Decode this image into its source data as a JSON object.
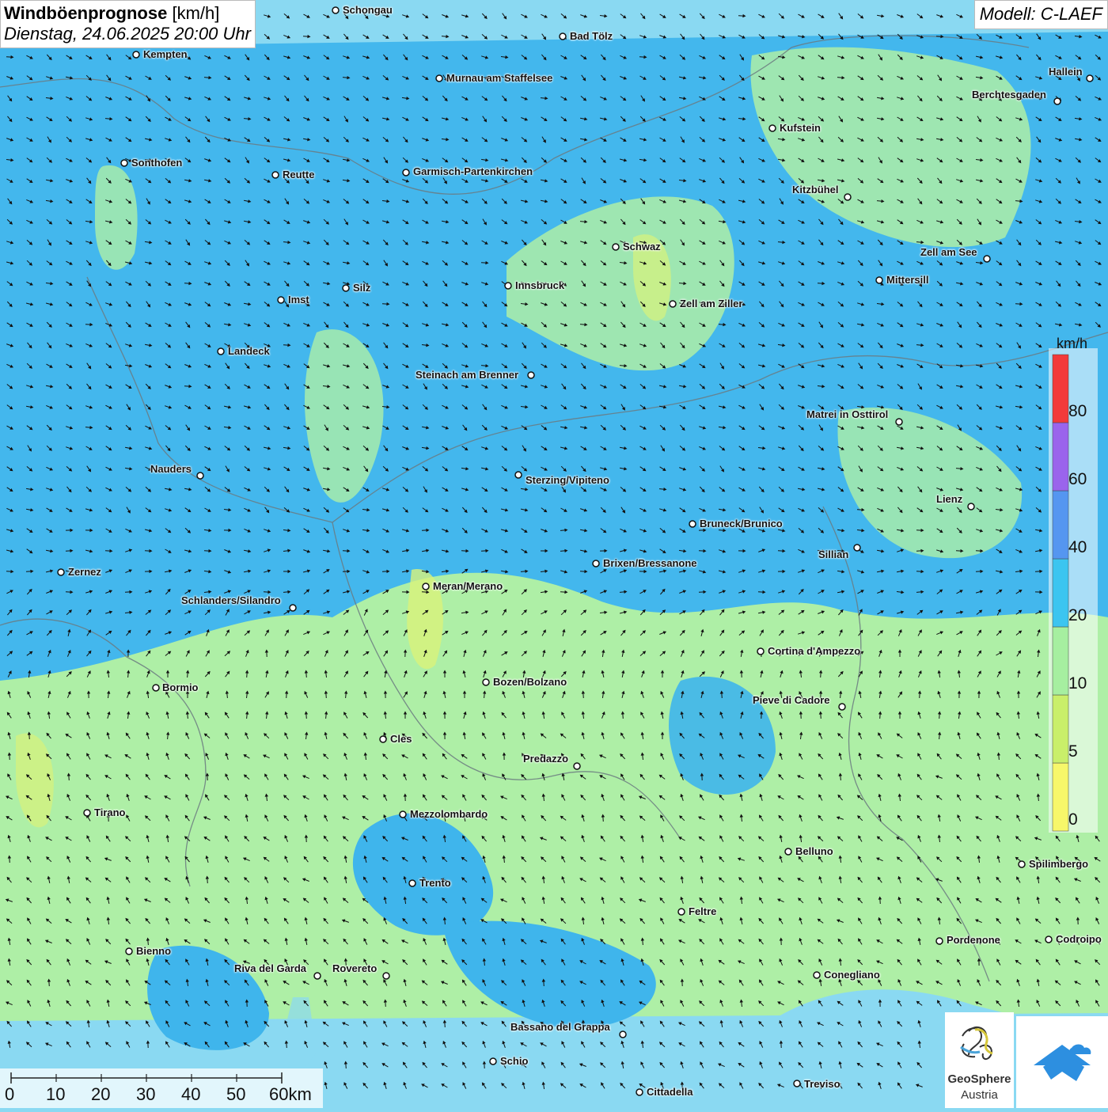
{
  "title": {
    "main": "Windböenprognose",
    "unit": "[km/h]",
    "datetime": "Dienstag, 24.06.2025 20:00 Uhr"
  },
  "model": "Modell: C-LAEF",
  "cities": [
    {
      "name": "Schongau"
    },
    {
      "name": "Bad Tölz"
    },
    {
      "name": "Kempten"
    },
    {
      "name": "Murnau am Staffelsee"
    },
    {
      "name": "Hallein"
    },
    {
      "name": "Berchtesgaden"
    },
    {
      "name": "Kufstein"
    },
    {
      "name": "Sonthofen"
    },
    {
      "name": "Reutte"
    },
    {
      "name": "Garmisch-Partenkirchen"
    },
    {
      "name": "Kitzbühel"
    },
    {
      "name": "Schwaz"
    },
    {
      "name": "Zell am See"
    },
    {
      "name": "Mittersill"
    },
    {
      "name": "Innsbruck"
    },
    {
      "name": "Silz"
    },
    {
      "name": "Imst"
    },
    {
      "name": "Zell am Ziller"
    },
    {
      "name": "Landeck"
    },
    {
      "name": "Steinach am Brenner"
    },
    {
      "name": "Matrei in Osttirol"
    },
    {
      "name": "Nauders"
    },
    {
      "name": "Sterzing/Vipiteno"
    },
    {
      "name": "Lienz"
    },
    {
      "name": "Bruneck/Brunico"
    },
    {
      "name": "Sillian"
    },
    {
      "name": "Brixen/Bressanone"
    },
    {
      "name": "Zernez"
    },
    {
      "name": "Meran/Merano"
    },
    {
      "name": "Schlanders/Silandro"
    },
    {
      "name": "Cortina d'Ampezzo"
    },
    {
      "name": "Bozen/Bolzano"
    },
    {
      "name": "Bormio"
    },
    {
      "name": "Pieve di Cadore"
    },
    {
      "name": "Cles"
    },
    {
      "name": "Predazzo"
    },
    {
      "name": "Tirano"
    },
    {
      "name": "Mezzolombardo"
    },
    {
      "name": "Belluno"
    },
    {
      "name": "Spilimbergo"
    },
    {
      "name": "Trento"
    },
    {
      "name": "Feltre"
    },
    {
      "name": "Bienno"
    },
    {
      "name": "Pordenone"
    },
    {
      "name": "Codroipo"
    },
    {
      "name": "Riva del Garda"
    },
    {
      "name": "Rovereto"
    },
    {
      "name": "Conegliano"
    },
    {
      "name": "Bassano del Grappa"
    },
    {
      "name": "Schio"
    },
    {
      "name": "Treviso"
    },
    {
      "name": "Cittadella"
    }
  ],
  "legend": {
    "unit": "km/h",
    "ticks": [
      "0",
      "5",
      "10",
      "20",
      "40",
      "60",
      "80"
    ],
    "colors": [
      "#f7f76a",
      "#c9ef6a",
      "#a6efa0",
      "#3cc5f0",
      "#5596f0",
      "#9a64ec",
      "#f23a3a"
    ]
  },
  "scale": {
    "labels": [
      "0",
      "10",
      "20",
      "30",
      "40",
      "50",
      "60km"
    ]
  },
  "logo": {
    "brand": "GeoSphere",
    "country": "Austria"
  },
  "fill_colors": {
    "sky": "#8ad9f2",
    "blue": "#3fb5ec",
    "green": "#aeefa6",
    "yellow": "#d9f27a"
  },
  "wind": {
    "north_direction": "southeast",
    "south_direction": "northwest"
  }
}
